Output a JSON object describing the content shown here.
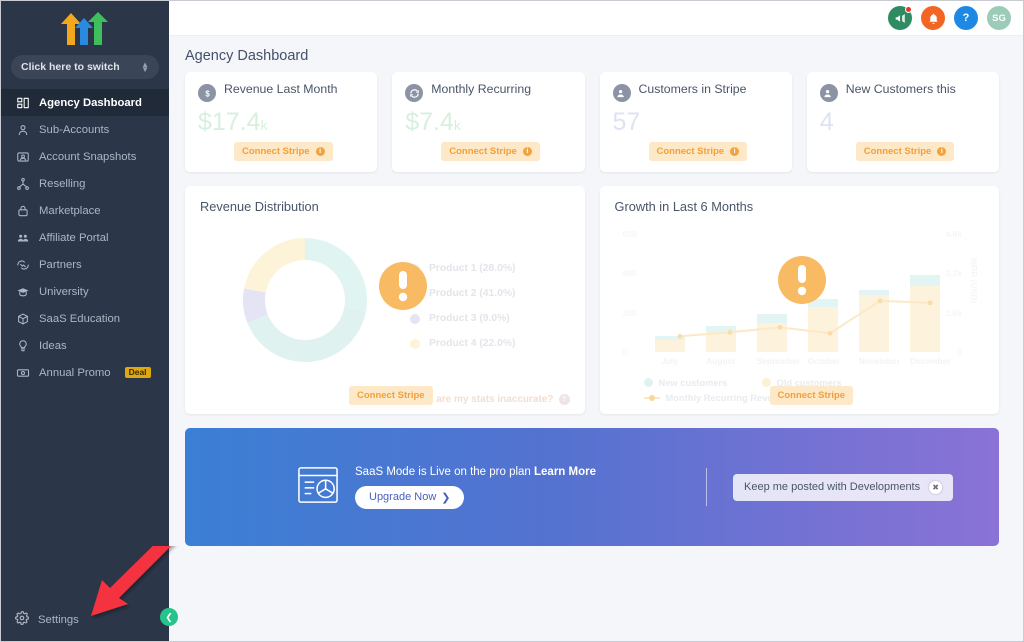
{
  "sidebar": {
    "switcher_label": "Click here to switch",
    "items": [
      {
        "label": "Agency Dashboard",
        "icon": "dashboard-grid-icon",
        "active": true
      },
      {
        "label": "Sub-Accounts",
        "icon": "user-icon",
        "active": false
      },
      {
        "label": "Account Snapshots",
        "icon": "photo-user-icon",
        "active": false
      },
      {
        "label": "Reselling",
        "icon": "network-share-icon",
        "active": false
      },
      {
        "label": "Marketplace",
        "icon": "lock-icon",
        "active": false
      },
      {
        "label": "Affiliate Portal",
        "icon": "people-group-icon",
        "active": false
      },
      {
        "label": "Partners",
        "icon": "handshake-icon",
        "active": false
      },
      {
        "label": "University",
        "icon": "graduation-cap-icon",
        "active": false
      },
      {
        "label": "SaaS Education",
        "icon": "box-cube-icon",
        "active": false
      },
      {
        "label": "Ideas",
        "icon": "lightbulb-icon",
        "active": false
      },
      {
        "label": "Annual Promo",
        "icon": "banknote-icon",
        "active": false,
        "badge": "Deal"
      }
    ],
    "settings_label": "Settings",
    "collapse_icon": "chevron-left-icon"
  },
  "topbar": {
    "icons": [
      {
        "name": "megaphone-icon",
        "glyph": "◂",
        "color": "#2e8b62",
        "badge": true
      },
      {
        "name": "bell-icon",
        "glyph": "●",
        "color": "#f26522",
        "badge": false
      },
      {
        "name": "help-icon",
        "glyph": "?",
        "color": "#1e88e5",
        "badge": false
      }
    ],
    "avatar_initials": "SG",
    "avatar_color": "#9ccbb8"
  },
  "page": {
    "title": "Agency Dashboard"
  },
  "kpis": [
    {
      "title": "Revenue Last Month",
      "value": "$17.4",
      "suffix": "k",
      "icon": "dollar-circle-icon",
      "value_tone": "green",
      "cta": "Connect Stripe"
    },
    {
      "title": "Monthly Recurring Revenue",
      "value": "$7.4",
      "suffix": "k",
      "icon": "refresh-circle-icon",
      "value_tone": "green",
      "cta": "Connect Stripe"
    },
    {
      "title": "Customers in Stripe",
      "value": "57",
      "suffix": "",
      "icon": "customer-circle-icon",
      "value_tone": "blue",
      "cta": "Connect Stripe"
    },
    {
      "title": "New Customers this Month",
      "value": "4",
      "suffix": "",
      "icon": "new-customer-circle-icon",
      "value_tone": "blue",
      "cta": "Connect Stripe"
    }
  ],
  "revenue_card": {
    "title": "Revenue Distribution",
    "cta": "Connect Stripe",
    "help_text": "Why are my stats inaccurate?",
    "warning_icon": "exclamation-icon"
  },
  "growth_card": {
    "title": "Growth in Last 6 Months",
    "cta": "Connect Stripe",
    "warning_icon": "exclamation-icon"
  },
  "banner": {
    "headline_plain": "SaaS Mode is Live on the pro plan ",
    "headline_link": "Learn More",
    "button_label": "Upgrade Now",
    "button_icon": "chevron-right-icon",
    "icon": "saas-window-icon",
    "chip_label": "Keep me posted with Developments",
    "chip_close_icon": "close-icon"
  },
  "chart_data": [
    {
      "type": "pie",
      "title": "Revenue Distribution",
      "labels": [
        "Product 1 (28.0%)",
        "Product 2 (41.0%)",
        "Product 3 (9.0%)",
        "Product 4 (22.0%)"
      ],
      "values": [
        28.0,
        41.0,
        9.0,
        22.0
      ],
      "colors": [
        "#e0f4f2",
        "#dff2ef",
        "#e4e4f4",
        "#fdf3d8"
      ],
      "legend_position": "right",
      "donut": true
    },
    {
      "type": "bar",
      "title": "Growth in Last 6 Months",
      "categories": [
        "July",
        "August",
        "September",
        "October",
        "November",
        "December"
      ],
      "series": [
        {
          "name": "Old customers",
          "type": "bar",
          "color": "#fdf2db",
          "values": [
            60,
            100,
            150,
            230,
            290,
            335
          ]
        },
        {
          "name": "New customers",
          "type": "bar",
          "color": "#e3f4f4",
          "values": [
            20,
            30,
            45,
            40,
            25,
            55
          ]
        },
        {
          "name": "Monthly Recurring Revenue",
          "type": "line",
          "color": "#fbe9c8",
          "values": [
            640,
            800,
            1000,
            760,
            2080,
            2000
          ]
        }
      ],
      "ylabel": "",
      "y2label": "MRR (USD)",
      "yticks": [
        "0",
        "200",
        "400",
        "600"
      ],
      "y2ticks": [
        "0",
        "1.6k",
        "3.2k",
        "4.8k"
      ],
      "ylim": [
        0,
        600
      ],
      "y2lim": [
        0,
        4800
      ],
      "grid": false,
      "legend_position": "bottom"
    }
  ]
}
